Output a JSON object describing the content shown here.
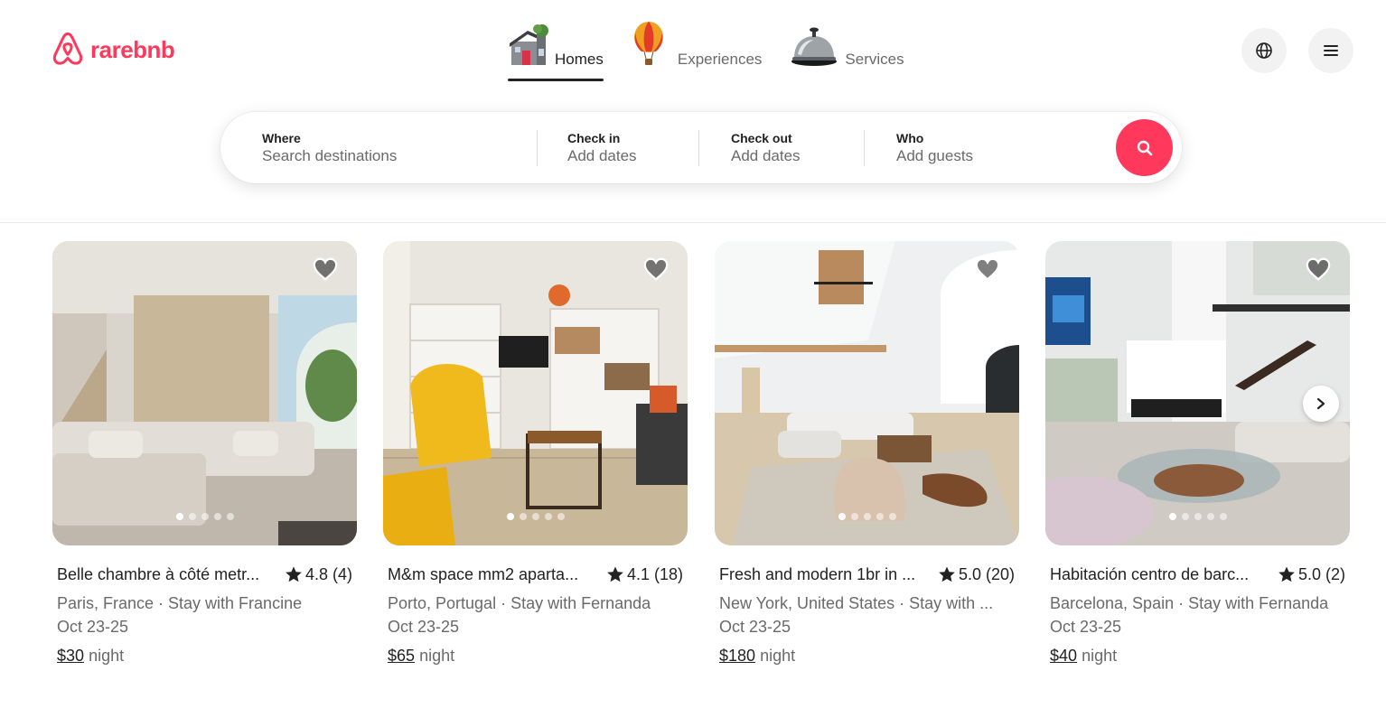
{
  "brand": {
    "name": "rarebnb",
    "color": "#ff385c"
  },
  "nav": {
    "tabs": [
      {
        "label": "Homes",
        "icon": "house-icon",
        "active": true
      },
      {
        "label": "Experiences",
        "icon": "hot-air-balloon-icon",
        "active": false
      },
      {
        "label": "Services",
        "icon": "service-bell-icon",
        "active": false
      }
    ]
  },
  "header_actions": {
    "language_icon": "globe-icon",
    "menu_icon": "hamburger-menu-icon"
  },
  "search": {
    "where": {
      "label": "Where",
      "placeholder": "Search destinations"
    },
    "check_in": {
      "label": "Check in",
      "value": "Add dates"
    },
    "check_out": {
      "label": "Check out",
      "value": "Add dates"
    },
    "who": {
      "label": "Who",
      "value": "Add guests"
    },
    "button_icon": "search-icon"
  },
  "listings": [
    {
      "title": "Belle chambre à côté metr...",
      "rating": "4.8 (4)",
      "subtitle": "Paris, France · Stay with Francine",
      "dates": "Oct 23-25",
      "price": "$30",
      "price_unit": "night"
    },
    {
      "title": "M&m space mm2 aparta...",
      "rating": "4.1 (18)",
      "subtitle": "Porto, Portugal · Stay with Fernanda",
      "dates": "Oct 23-25",
      "price": "$65",
      "price_unit": "night"
    },
    {
      "title": "Fresh and modern 1br in ...",
      "rating": "5.0 (20)",
      "subtitle": "New York, United States · Stay with ...",
      "dates": "Oct 23-25",
      "price": "$180",
      "price_unit": "night"
    },
    {
      "title": "Habitación centro de barc...",
      "rating": "5.0 (2)",
      "subtitle": "Barcelona, Spain · Stay with Fernanda",
      "dates": "Oct 23-25",
      "price": "$40",
      "price_unit": "night"
    }
  ]
}
